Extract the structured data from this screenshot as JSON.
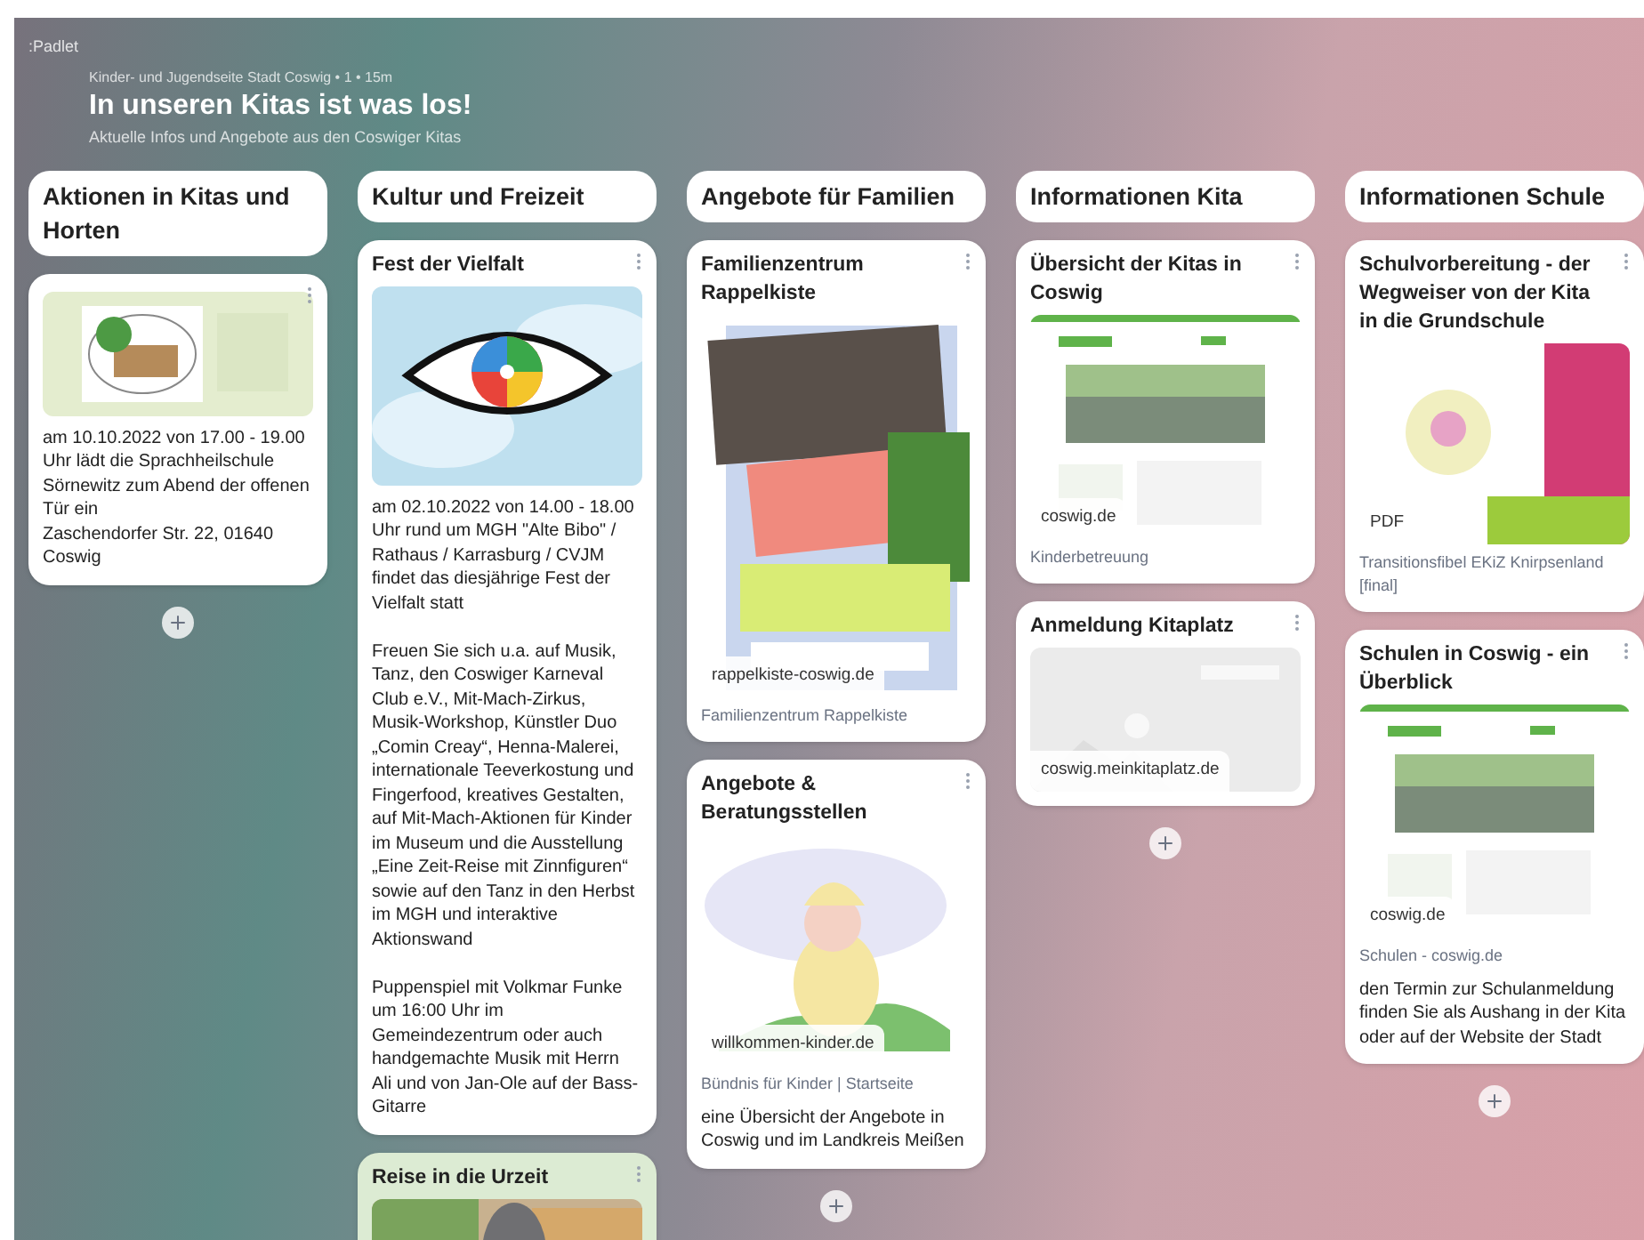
{
  "app": {
    "logo": ":Padlet"
  },
  "header": {
    "meta": "Kinder- und Jugendseite Stadt Coswig • 1 • 15m",
    "title": "In unseren Kitas ist was los!",
    "subtitle": "Aktuelle Infos und Angebote aus den Coswiger Kitas"
  },
  "columns": [
    {
      "title": "Aktionen in Kitas und Horten",
      "posts": [
        {
          "color": "#ffffff",
          "media": {
            "kind": "picture"
          },
          "body": [
            "am 10.10.2022 von 17.00 - 19.00 Uhr lädt die Sprachheilschule Sörnewitz zum Abend der offenen Tür ein\nZaschendorfer Str. 22, 01640 Coswig"
          ]
        }
      ]
    },
    {
      "title": "Kultur und Freizeit",
      "posts": [
        {
          "color": "#ffffff",
          "title": "Fest der Vielfalt",
          "media": {
            "kind": "picture"
          },
          "body": [
            "am 02.10.2022 von 14.00 - 18.00 Uhr rund um MGH \"Alte Bibo\" / Rathaus / Karrasburg / CVJM findet das diesjährige Fest der Vielfalt statt",
            "Freuen Sie sich u.a. auf Musik, Tanz, den Coswiger Karneval Club e.V., Mit-Mach-Zirkus, Musik-Workshop, Künstler Duo „Comin Creay“, Henna-Malerei, internationale Teeverkostung und Fingerfood, kreatives Gestalten, auf Mit-Mach-Aktionen für Kinder im Museum und die Ausstellung „Eine Zeit-Reise mit Zinnfiguren“ sowie auf den Tanz in den Herbst im MGH und interaktive Aktionswand",
            "Puppenspiel mit Volkmar Funke um 16:00 Uhr im Gemeindezentrum oder auch handgemachte Musik mit Herrn Ali und von Jan-Ole auf der Bass-Gitarre"
          ]
        },
        {
          "color": "#dcebd3",
          "title": "Reise in die Urzeit",
          "media": {
            "kind": "picture"
          }
        }
      ]
    },
    {
      "title": "Angebote für Familien",
      "posts": [
        {
          "color": "#ffffff",
          "title": "Familienzentrum Rappelkiste",
          "media": {
            "kind": "picture",
            "link": "rappelkiste-coswig.de"
          },
          "source": "Familienzentrum Rappelkiste"
        },
        {
          "color": "#ffffff",
          "title": "Angebote & Beratungsstellen",
          "media": {
            "kind": "picture",
            "link": "willkommen-kinder.de"
          },
          "source": "Bündnis für Kinder | Startseite",
          "body": [
            "eine Übersicht der Angebote in Coswig und im Landkreis Meißen"
          ]
        }
      ]
    },
    {
      "title": "Informationen Kita",
      "posts": [
        {
          "color": "#ffffff",
          "title": "Übersicht der Kitas in Coswig",
          "media": {
            "kind": "picture",
            "link": "coswig.de"
          },
          "source": "Kinderbetreuung"
        },
        {
          "color": "#ffffff",
          "title": "Anmeldung Kitaplatz",
          "media": {
            "kind": "picture",
            "link": "coswig.meinkitaplatz.de"
          }
        }
      ]
    },
    {
      "title": "Informationen Schule",
      "posts": [
        {
          "color": "#ffffff",
          "title": "Schulvorbereitung - der Wegweiser von der Kita in die Grundschule",
          "media": {
            "kind": "picture",
            "badge": "PDF"
          },
          "source": "Transitionsfibel EKiZ Knirpsenland [final]"
        },
        {
          "color": "#ffffff",
          "title": "Schulen in Coswig - ein Überblick",
          "media": {
            "kind": "picture",
            "link": "coswig.de"
          },
          "source": "Schulen - coswig.de",
          "body": [
            "den Termin zur Schulanmeldung finden Sie als Aushang in der Kita oder auf der Website der Stadt"
          ]
        }
      ]
    }
  ]
}
